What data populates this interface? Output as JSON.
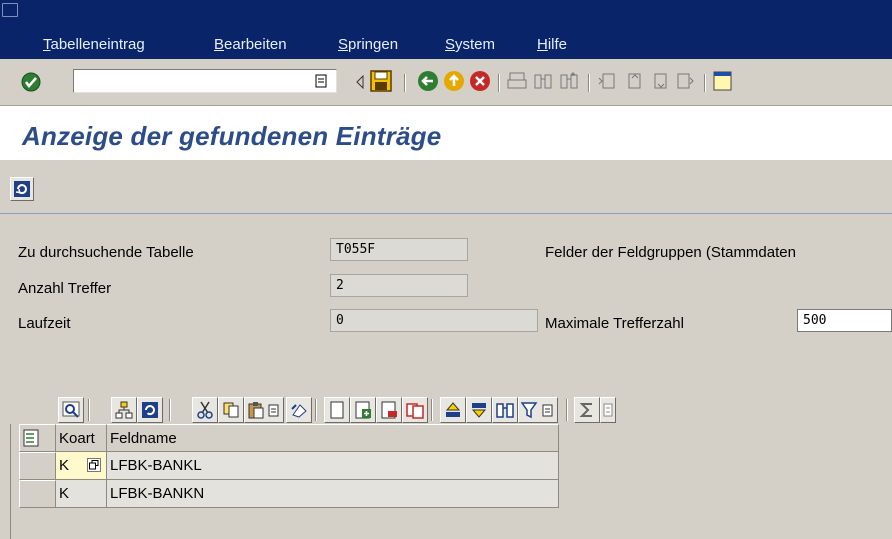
{
  "menu": {
    "items": [
      "Tabelleneintrag",
      "Bearbeiten",
      "Springen",
      "System",
      "Hilfe"
    ]
  },
  "toolbar": {
    "command_value": ""
  },
  "page": {
    "title": "Anzeige der gefundenen Einträge"
  },
  "form": {
    "table_label": "Zu durchsuchende Tabelle",
    "table_value": "T055F",
    "hits_label": "Anzahl Treffer",
    "hits_value": "2",
    "runtime_label": "Laufzeit",
    "runtime_value": "0",
    "fields_label": "Felder der Feldgruppen (Stammdaten",
    "max_hits_label": "Maximale Trefferzahl",
    "max_hits_value": "500"
  },
  "grid": {
    "columns": [
      "Koart",
      "Feldname"
    ],
    "rows": [
      {
        "koart": "K",
        "feldname": "LFBK-BANKL"
      },
      {
        "koart": "K",
        "feldname": "LFBK-BANKN"
      }
    ]
  },
  "colors": {
    "menubar": "#0a246a",
    "title": "#2c4d8a",
    "background": "#d4d0c8"
  }
}
